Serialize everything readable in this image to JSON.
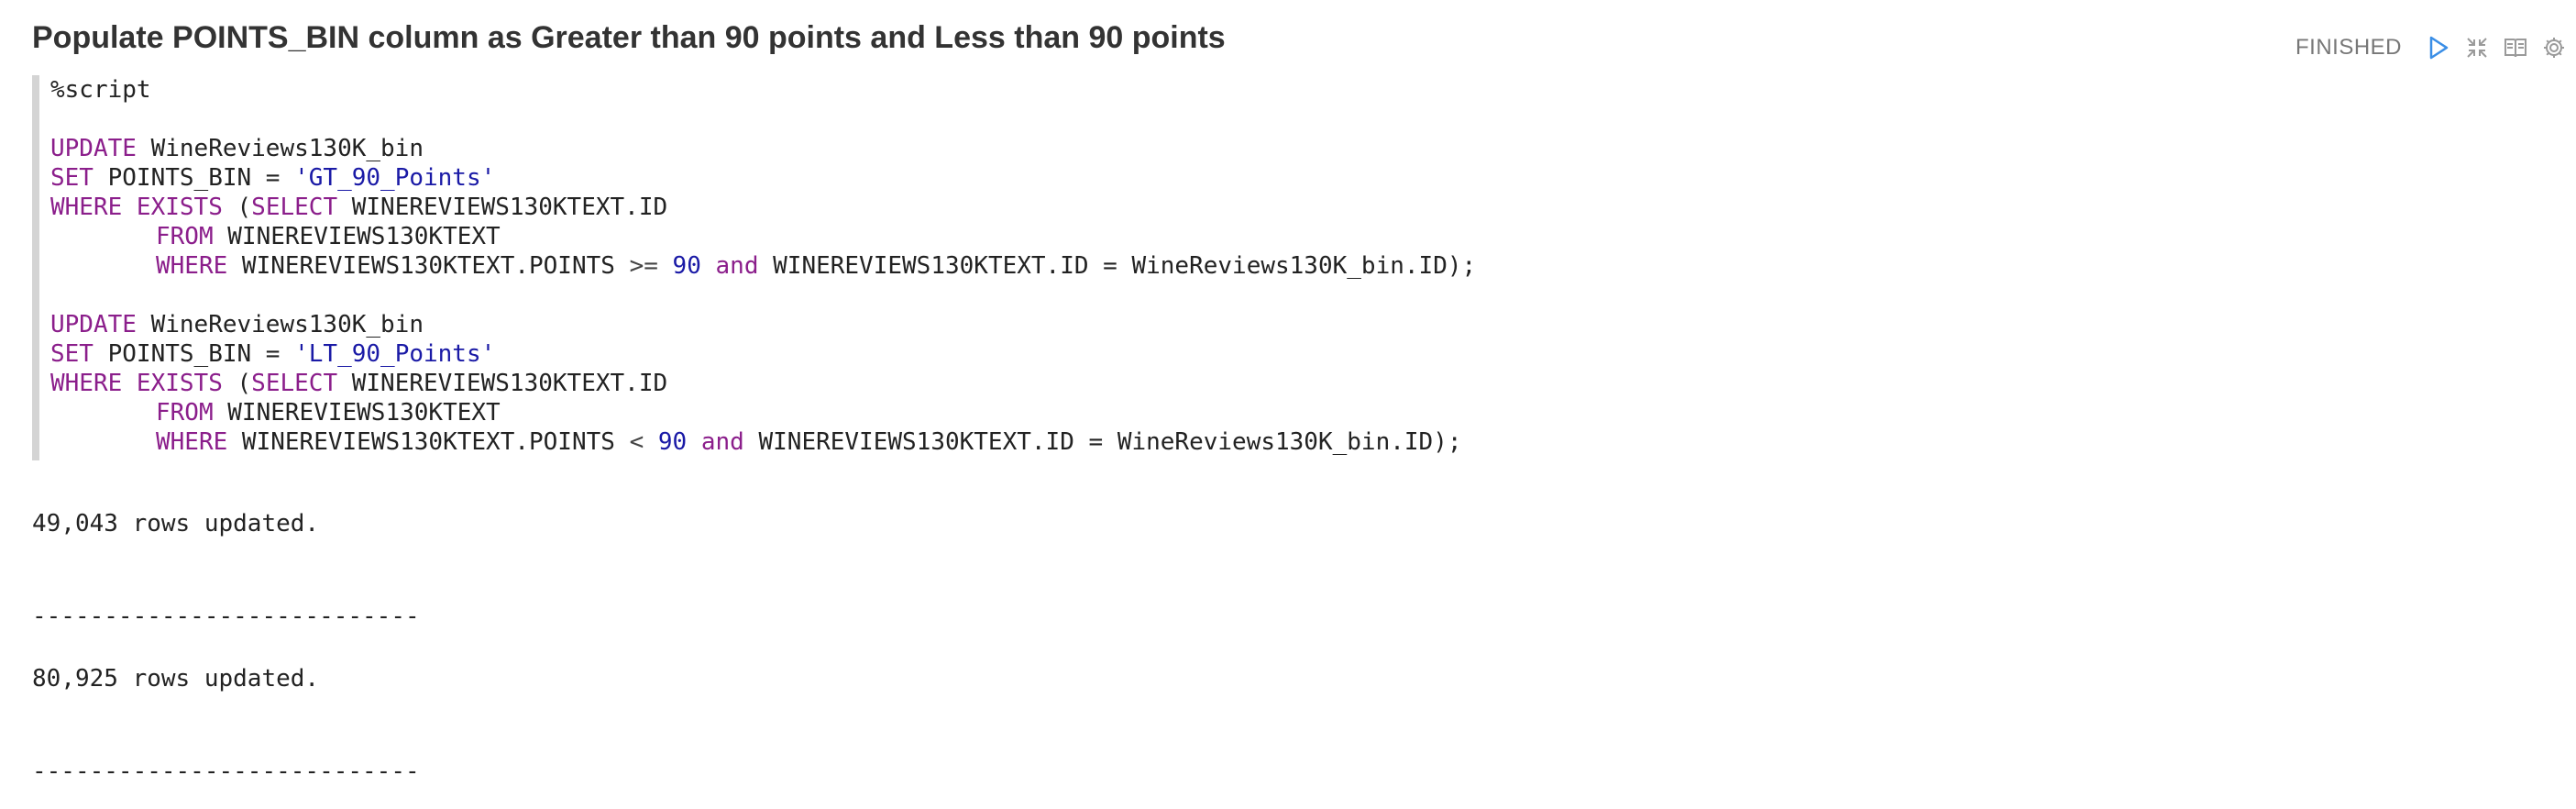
{
  "paragraph": {
    "title": "Populate POINTS_BIN column as Greater than 90 points and Less than 90 points",
    "status": "FINISHED"
  },
  "toolbar": {
    "icons": [
      "run-icon",
      "collapse-icon",
      "book-icon",
      "gear-icon"
    ]
  },
  "editor": {
    "directive": "%script",
    "blocks": [
      {
        "update_kw": "UPDATE",
        "table": " WineReviews130K_bin",
        "set_kw": "SET",
        "set_expr": " POINTS_BIN = ",
        "set_value": "'GT_90_Points'",
        "where_kw": "WHERE",
        "exists_kw": " EXISTS",
        "paren_open": " (",
        "select_kw": "SELECT",
        "select_expr": " WINEREVIEWS130KTEXT.ID",
        "from_kw": "FROM",
        "from_expr": " WINEREVIEWS130KTEXT",
        "where2_kw": "WHERE",
        "cond_left": " WINEREVIEWS130KTEXT.POINTS ",
        "cond_op": ">=",
        "cond_num": "90",
        "and_kw": "and",
        "cond_right": " WINEREVIEWS130KTEXT.ID = WineReviews130K_bin.ID);"
      },
      {
        "update_kw": "UPDATE",
        "table": " WineReviews130K_bin",
        "set_kw": "SET",
        "set_expr": " POINTS_BIN = ",
        "set_value": "'LT_90_Points'",
        "where_kw": "WHERE",
        "exists_kw": " EXISTS",
        "paren_open": " (",
        "select_kw": "SELECT",
        "select_expr": " WINEREVIEWS130KTEXT.ID",
        "from_kw": "FROM",
        "from_expr": " WINEREVIEWS130KTEXT",
        "where2_kw": "WHERE",
        "cond_left": " WINEREVIEWS130KTEXT.POINTS ",
        "cond_op": "<",
        "cond_num": "90",
        "and_kw": "and",
        "cond_right": " WINEREVIEWS130KTEXT.ID = WineReviews130K_bin.ID);"
      }
    ]
  },
  "output": {
    "result1": "49,043 rows updated.",
    "separator1": "---------------------------",
    "result2": "80,925 rows updated.",
    "separator2": "---------------------------"
  }
}
